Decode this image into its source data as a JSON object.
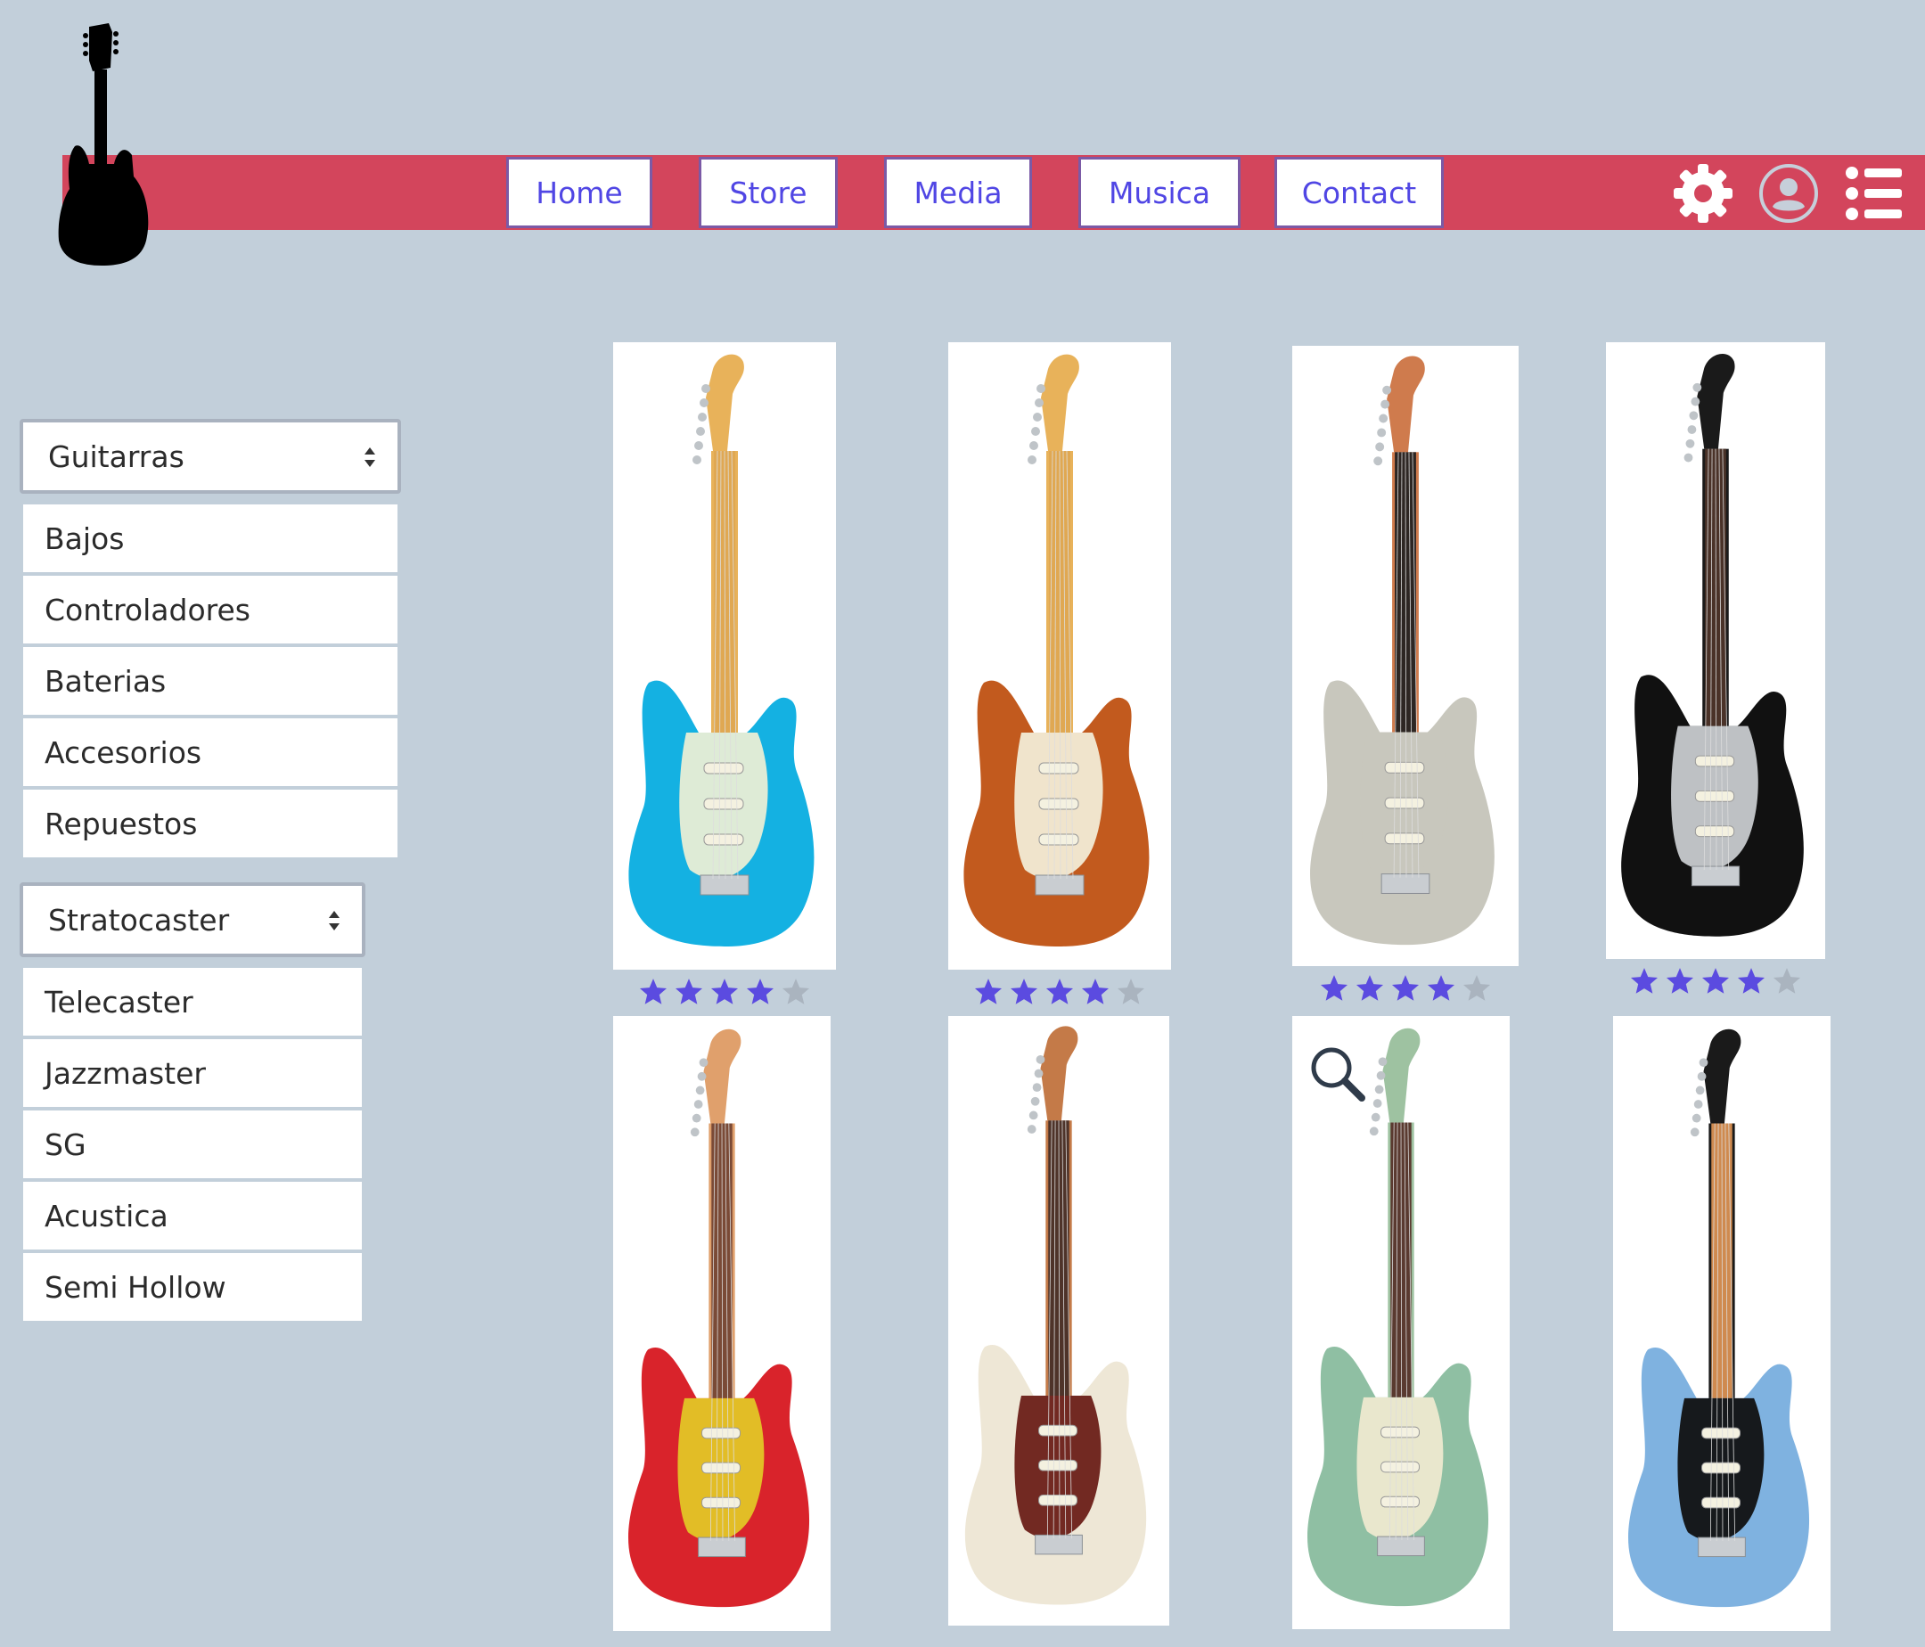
{
  "nav": {
    "items": [
      {
        "label": "Home"
      },
      {
        "label": "Store"
      },
      {
        "label": "Media"
      },
      {
        "label": "Musica"
      },
      {
        "label": "Contact"
      }
    ]
  },
  "header_icons": [
    "gear-icon",
    "user-circle-icon",
    "list-menu-icon"
  ],
  "sidebar": {
    "category_select": {
      "value": "Guitarras"
    },
    "categories": [
      "Bajos",
      "Controladores",
      "Baterias",
      "Accesorios",
      "Repuestos"
    ],
    "model_select": {
      "value": "Stratocaster"
    },
    "models": [
      "Telecaster",
      "Jazzmaster",
      "SG",
      "Acustica",
      "Semi Hollow"
    ]
  },
  "products": [
    {
      "name": "guitar-blue-stratocaster",
      "body": "#14b1e2",
      "neck": "#e8b25a",
      "fret": "#e0a852",
      "guard": "#e9eed5",
      "rating": 4
    },
    {
      "name": "guitar-sunburst-stratocaster",
      "body": "#c25a1e",
      "neck": "#e8b25a",
      "fret": "#e0a852",
      "guard": "#f2ecd6",
      "rating": 4
    },
    {
      "name": "guitar-acoustasonic-stratocaster",
      "body": "#c8c7bd",
      "neck": "#cf7b4d",
      "fret": "#2d2623",
      "guard": "#c8c7bd",
      "rating": 4
    },
    {
      "name": "guitar-black-stratocaster",
      "body": "#111111",
      "neck": "#1a1a1a",
      "fret": "#4a3228",
      "guard": "#c8cbcf",
      "rating": 4
    },
    {
      "name": "guitar-red-screamadelica-stratocaster",
      "body": "#d9232b",
      "neck": "#e0a06c",
      "fret": "#7a4a36",
      "guard": "#e3c626",
      "rating": null
    },
    {
      "name": "guitar-white-offset",
      "body": "#eee7d6",
      "neck": "#c47a48",
      "fret": "#4e3329",
      "guard": "#6a1f18",
      "rating": null
    },
    {
      "name": "guitar-green-jazzmaster-stratocaster",
      "body": "#8fbfa3",
      "neck": "#9ec2a1",
      "fret": "#5a3a30",
      "guard": "#eee9d0",
      "rating": null
    },
    {
      "name": "guitar-skyburst-stratocaster",
      "body": "#7fb2e0",
      "neck": "#1a1a1a",
      "fret": "#cf8a4f",
      "guard": "#111111",
      "rating": null
    }
  ]
}
